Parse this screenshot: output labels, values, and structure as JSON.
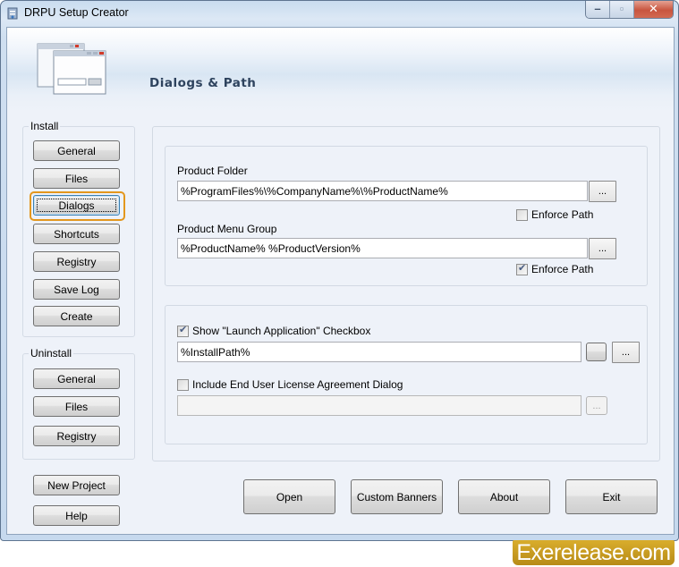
{
  "window": {
    "title": "DRPU Setup Creator",
    "controls": {
      "minimize": "minimize",
      "maximize": "maximize",
      "close": "close"
    }
  },
  "header": {
    "title": "Dialogs & Path"
  },
  "sidebar": {
    "install": {
      "legend": "Install",
      "items": [
        {
          "label": "General"
        },
        {
          "label": "Files"
        },
        {
          "label": "Dialogs",
          "selected": true
        },
        {
          "label": "Shortcuts"
        },
        {
          "label": "Registry"
        },
        {
          "label": "Save Log"
        },
        {
          "label": "Create"
        }
      ]
    },
    "uninstall": {
      "legend": "Uninstall",
      "items": [
        {
          "label": "General"
        },
        {
          "label": "Files"
        },
        {
          "label": "Registry"
        }
      ]
    },
    "new_project": "New Project",
    "help": "Help"
  },
  "paths": {
    "product_folder": {
      "label": "Product Folder",
      "value": "%ProgramFiles%\\%CompanyName%\\%ProductName%",
      "browse": "...",
      "enforce_label": "Enforce Path",
      "enforce_checked": false
    },
    "product_menu_group": {
      "label": "Product Menu Group",
      "value": "%ProductName% %ProductVersion%",
      "browse": "...",
      "enforce_label": "Enforce Path",
      "enforce_checked": true
    }
  },
  "dialogs": {
    "launch_app": {
      "label": "Show \"Launch Application\" Checkbox",
      "checked": true,
      "value": "%InstallPath%",
      "browse": "..."
    },
    "eula": {
      "label": "Include End User License Agreement Dialog",
      "checked": false,
      "value": "",
      "browse": "..."
    }
  },
  "footer": {
    "open": "Open",
    "custom_banners": "Custom Banners",
    "about": "About",
    "exit": "Exit"
  },
  "watermark": "Exerelease.com",
  "icons": {
    "tick": "✔",
    "minimize": "–",
    "maximize": "▫",
    "close": "✕"
  }
}
